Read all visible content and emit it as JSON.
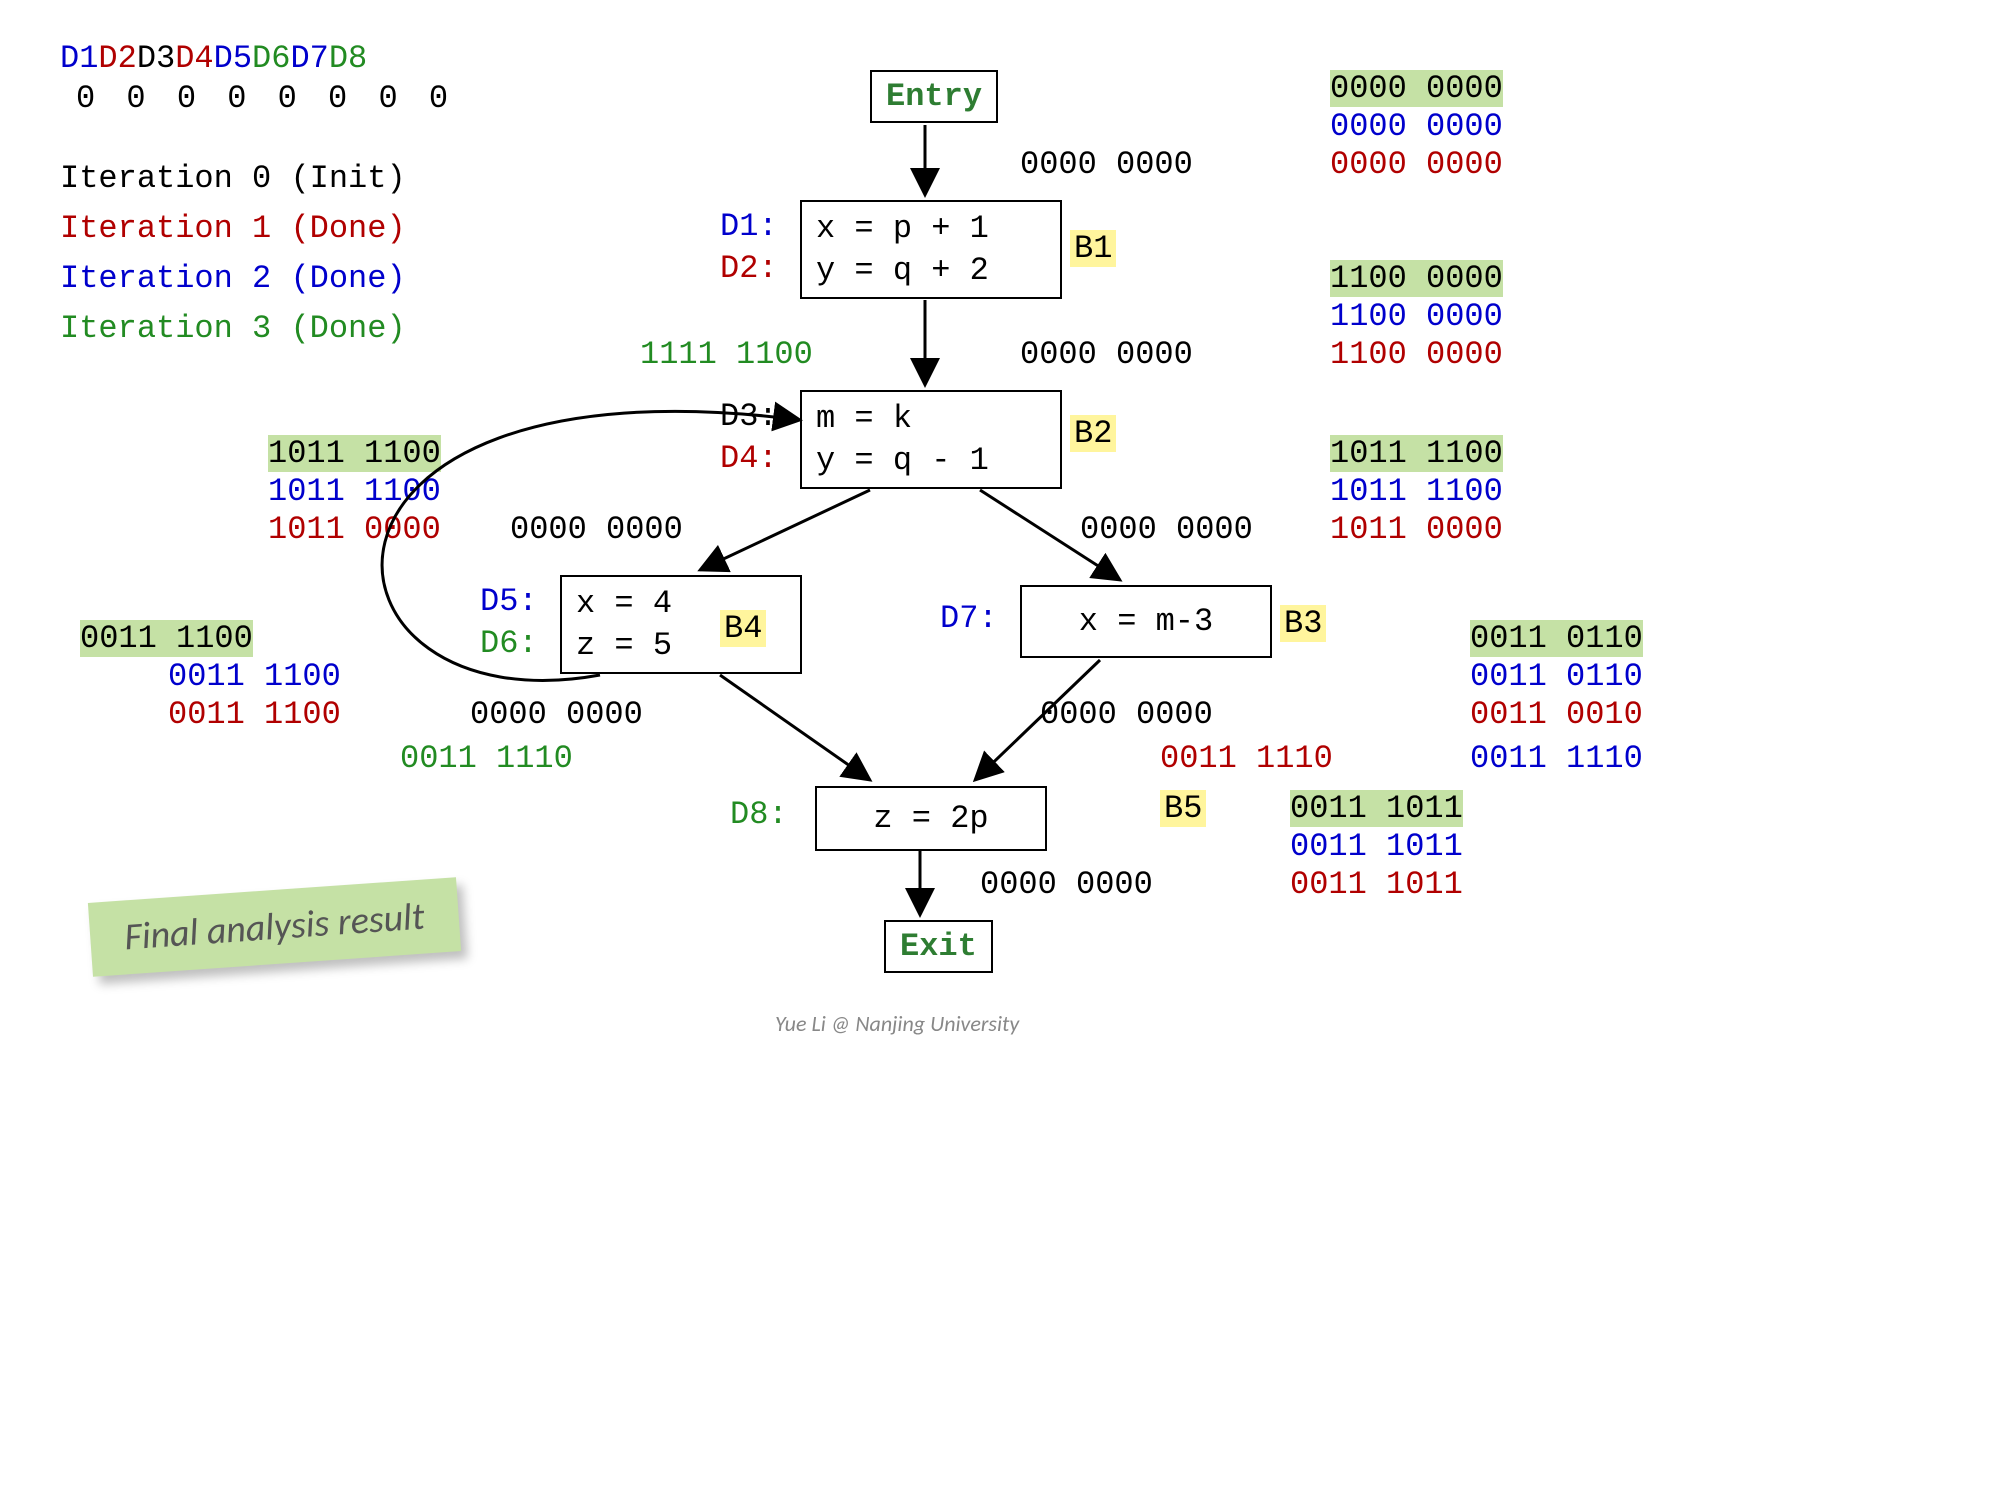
{
  "header": {
    "dlabels": [
      "D1",
      "D2",
      "D3",
      "D4",
      "D5",
      "D6",
      "D7",
      "D8"
    ],
    "dcolors": [
      "blue",
      "red",
      "black",
      "red",
      "blue",
      "green",
      "blue",
      "green"
    ],
    "zeros": "0 0 0 0 0 0 0 0"
  },
  "iterations": {
    "i0": "Iteration 0 (Init)",
    "i1": "Iteration 1 (Done)",
    "i2": "Iteration 2 (Done)",
    "i3": "Iteration 3 (Done)"
  },
  "nodes": {
    "entry": "Entry",
    "exit": "Exit",
    "b1": {
      "label": "B1",
      "d1": "D1:",
      "d2": "D2:",
      "l1": "x = p + 1",
      "l2": "y = q + 2"
    },
    "b2": {
      "label": "B2",
      "d3": "D3:",
      "d4": "D4:",
      "l1": "m = k",
      "l2": "y = q - 1"
    },
    "b3": {
      "label": "B3",
      "d7": "D7:",
      "l1": "x = m-3"
    },
    "b4": {
      "label": "B4",
      "d5": "D5:",
      "d6": "D6:",
      "l1": "x = 4",
      "l2": "z = 5"
    },
    "b5": {
      "label": "B5",
      "d8": "D8:",
      "l1": "z = 2p"
    }
  },
  "bits": {
    "entry_in_black": "0000 0000",
    "entry_out_g": "0000 0000",
    "entry_out_b": "0000 0000",
    "entry_out_r": "0000 0000",
    "b1_in_black": "0000 0000",
    "b1_out_g": "1100 0000",
    "b1_out_b": "1100 0000",
    "b1_out_r": "1100 0000",
    "b2_top_green": "1111 1100",
    "b2_left_black": "0000 0000",
    "b2_right_black": "0000 0000",
    "b2_out_g": "1011 1100",
    "b2_out_b": "1011 1100",
    "b2_out_r": "1011 0000",
    "b4_in_g": "1011 1100",
    "b4_in_b": "1011 1100",
    "b4_in_r": "1011 0000",
    "b4_left_black": "0000 0000",
    "b4_out_g": "0011 1100",
    "b4_out_b": "0011 1100",
    "b4_out_r": "0011 1100",
    "b3_out_g": "0011 0110",
    "b3_out_b": "0011 0110",
    "b3_out_r": "0011 0010",
    "b3_left_black": "0000 0000",
    "b5_in_left_green": "0011 1110",
    "b5_in_right_red": "0011 1110",
    "b5_in_right_blue": "0011 1110",
    "b5_out_g": "0011 1011",
    "b5_out_b": "0011 1011",
    "b5_out_r": "0011 1011",
    "b5_below_black": "0000 0000"
  },
  "sticker": "Final analysis result",
  "footer": "Yue Li @ Nanjing University"
}
